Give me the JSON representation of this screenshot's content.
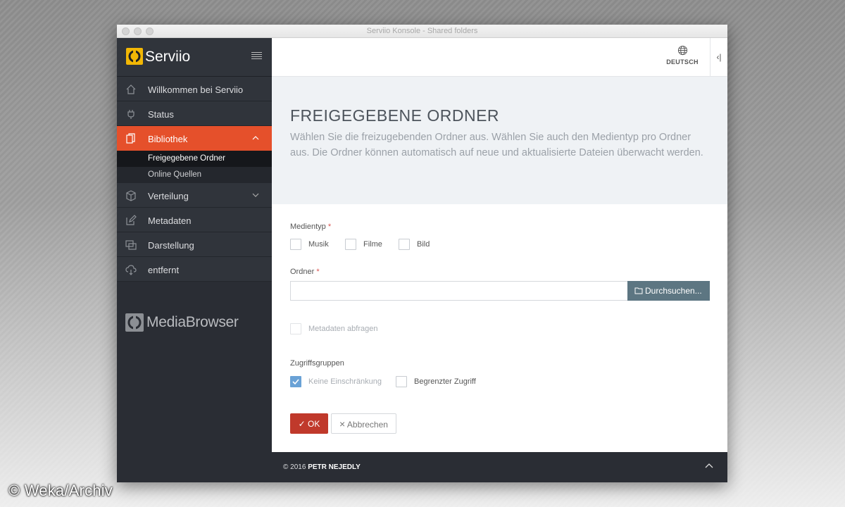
{
  "window": {
    "title": "Serviio Konsole - Shared folders"
  },
  "brand": {
    "name": "Serviio"
  },
  "nav": {
    "items": [
      {
        "label": "Willkommen bei Serviio",
        "icon": "home-icon"
      },
      {
        "label": "Status",
        "icon": "plug-icon"
      },
      {
        "label": "Bibliothek",
        "icon": "library-icon",
        "active": true
      },
      {
        "label": "Verteilung",
        "icon": "cube-icon"
      },
      {
        "label": "Metadaten",
        "icon": "edit-icon"
      },
      {
        "label": "Darstellung",
        "icon": "presentation-icon"
      },
      {
        "label": "entfernt",
        "icon": "cloud-icon"
      }
    ],
    "sub_items": [
      {
        "label": "Freigegebene Ordner",
        "active": true
      },
      {
        "label": "Online Quellen"
      }
    ]
  },
  "mediabrowser": {
    "name": "MediaBrowser"
  },
  "topbar": {
    "language": "DEUTSCH"
  },
  "page": {
    "title": "FREIGEGEBENE ORDNER",
    "description": "Wählen Sie die freizugebenden Ordner aus. Wählen Sie auch den Medientyp pro Ordner aus. Die Ordner können automatisch auf neue und aktualisierte Dateien überwacht werden."
  },
  "form": {
    "media_type_label": "Medientyp",
    "required_mark": "*",
    "media_types": [
      "Musik",
      "Filme",
      "Bild"
    ],
    "folder_label": "Ordner",
    "folder_value": "",
    "browse_label": "Durchsuchen...",
    "metadata_label": "Metadaten abfragen",
    "access_label": "Zugriffsgruppen",
    "access_options": [
      {
        "label": "Keine Einschränkung",
        "checked": true
      },
      {
        "label": "Begrenzter Zugriff",
        "checked": false
      }
    ],
    "ok_label": "OK",
    "cancel_label": "Abbrechen"
  },
  "footer": {
    "copyright": "© 2016",
    "author": "PETR NEJEDLY"
  },
  "watermark": "© Weka/Archiv",
  "colors": {
    "accent": "#e5502b",
    "sidebar": "#2a2d34",
    "ok": "#c0392b",
    "browse": "#5d7682",
    "checkbox": "#6aa2d6"
  }
}
